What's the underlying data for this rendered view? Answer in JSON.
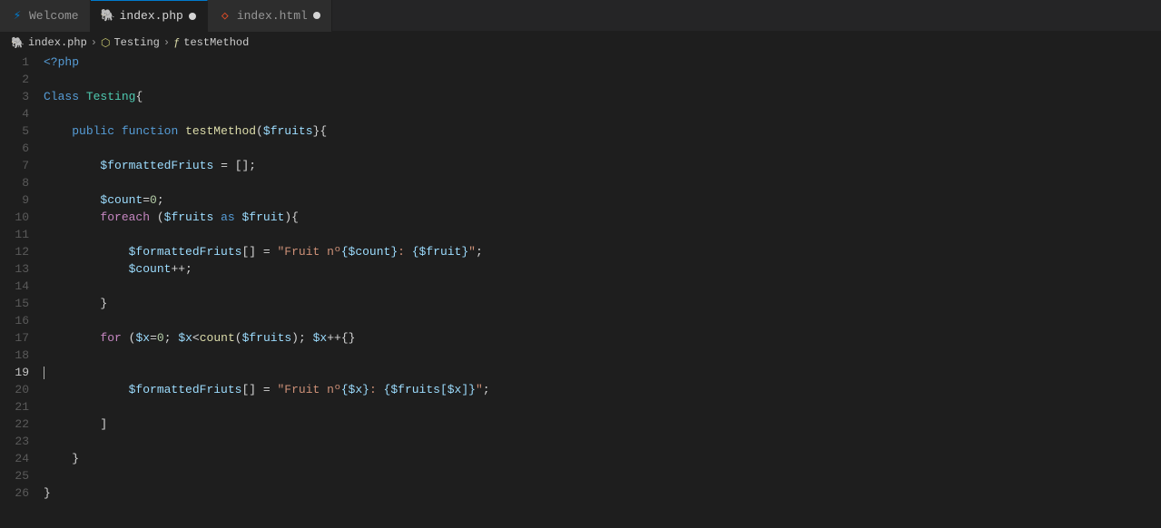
{
  "tabs": [
    {
      "id": "welcome",
      "label": "Welcome",
      "icon": "vscode",
      "active": false,
      "modified": false
    },
    {
      "id": "index-php",
      "label": "index.php",
      "icon": "php",
      "active": true,
      "modified": true
    },
    {
      "id": "index-html",
      "label": "index.html",
      "icon": "html",
      "active": false,
      "modified": true
    }
  ],
  "breadcrumb": {
    "items": [
      {
        "label": "index.php",
        "icon": "php"
      },
      {
        "label": "Testing",
        "icon": "class"
      },
      {
        "label": "testMethod",
        "icon": "method"
      }
    ]
  },
  "lines": [
    {
      "num": 1,
      "tokens": [
        {
          "t": "tag",
          "v": "<?php"
        }
      ]
    },
    {
      "num": 2,
      "tokens": []
    },
    {
      "num": 3,
      "tokens": [
        {
          "t": "kw",
          "v": "Class"
        },
        {
          "t": "plain",
          "v": " "
        },
        {
          "t": "cls",
          "v": "Testing"
        },
        {
          "t": "punct",
          "v": "{"
        }
      ]
    },
    {
      "num": 4,
      "tokens": []
    },
    {
      "num": 5,
      "tokens": [
        {
          "t": "plain",
          "v": "    "
        },
        {
          "t": "kw",
          "v": "public"
        },
        {
          "t": "plain",
          "v": " "
        },
        {
          "t": "kw",
          "v": "function"
        },
        {
          "t": "plain",
          "v": " "
        },
        {
          "t": "fn",
          "v": "testMethod"
        },
        {
          "t": "punct",
          "v": "("
        },
        {
          "t": "var",
          "v": "$fruits"
        },
        {
          "t": "punct",
          "v": "}{"
        }
      ]
    },
    {
      "num": 6,
      "tokens": []
    },
    {
      "num": 7,
      "tokens": [
        {
          "t": "plain",
          "v": "        "
        },
        {
          "t": "var",
          "v": "$formattedFriuts"
        },
        {
          "t": "plain",
          "v": " "
        },
        {
          "t": "op",
          "v": "="
        },
        {
          "t": "plain",
          "v": " "
        },
        {
          "t": "punct",
          "v": "[]"
        },
        {
          "t": "punct",
          "v": ";"
        }
      ]
    },
    {
      "num": 8,
      "tokens": []
    },
    {
      "num": 9,
      "tokens": [
        {
          "t": "plain",
          "v": "        "
        },
        {
          "t": "var",
          "v": "$count"
        },
        {
          "t": "op",
          "v": "="
        },
        {
          "t": "num",
          "v": "0"
        },
        {
          "t": "punct",
          "v": ";"
        }
      ]
    },
    {
      "num": 10,
      "tokens": [
        {
          "t": "plain",
          "v": "        "
        },
        {
          "t": "kw2",
          "v": "foreach"
        },
        {
          "t": "plain",
          "v": " "
        },
        {
          "t": "punct",
          "v": "("
        },
        {
          "t": "var",
          "v": "$fruits"
        },
        {
          "t": "plain",
          "v": " "
        },
        {
          "t": "kw",
          "v": "as"
        },
        {
          "t": "plain",
          "v": " "
        },
        {
          "t": "var",
          "v": "$fruit"
        },
        {
          "t": "punct",
          "v": "){"
        }
      ]
    },
    {
      "num": 11,
      "tokens": []
    },
    {
      "num": 12,
      "tokens": [
        {
          "t": "plain",
          "v": "            "
        },
        {
          "t": "var",
          "v": "$formattedFriuts"
        },
        {
          "t": "punct",
          "v": "[]"
        },
        {
          "t": "plain",
          "v": " "
        },
        {
          "t": "op",
          "v": "="
        },
        {
          "t": "plain",
          "v": " "
        },
        {
          "t": "str",
          "v": "\"Fruit nº"
        },
        {
          "t": "interp",
          "v": "{$count}"
        },
        {
          "t": "str",
          "v": ": "
        },
        {
          "t": "interp",
          "v": "{$fruit}"
        },
        {
          "t": "str",
          "v": "\""
        },
        {
          "t": "punct",
          "v": ";"
        }
      ]
    },
    {
      "num": 13,
      "tokens": [
        {
          "t": "plain",
          "v": "            "
        },
        {
          "t": "var",
          "v": "$count"
        },
        {
          "t": "op",
          "v": "++"
        },
        {
          "t": "punct",
          "v": ";"
        }
      ]
    },
    {
      "num": 14,
      "tokens": []
    },
    {
      "num": 15,
      "tokens": [
        {
          "t": "plain",
          "v": "        "
        },
        {
          "t": "punct",
          "v": "}"
        }
      ]
    },
    {
      "num": 16,
      "tokens": []
    },
    {
      "num": 17,
      "tokens": [
        {
          "t": "plain",
          "v": "        "
        },
        {
          "t": "kw2",
          "v": "for"
        },
        {
          "t": "plain",
          "v": " "
        },
        {
          "t": "punct",
          "v": "("
        },
        {
          "t": "var",
          "v": "$x"
        },
        {
          "t": "op",
          "v": "="
        },
        {
          "t": "num",
          "v": "0"
        },
        {
          "t": "punct",
          "v": ";"
        },
        {
          "t": "plain",
          "v": " "
        },
        {
          "t": "var",
          "v": "$x"
        },
        {
          "t": "op",
          "v": "<"
        },
        {
          "t": "fn",
          "v": "count"
        },
        {
          "t": "punct",
          "v": "("
        },
        {
          "t": "var",
          "v": "$fruits"
        },
        {
          "t": "punct",
          "v": ")"
        },
        {
          "t": "punct",
          "v": ";"
        },
        {
          "t": "plain",
          "v": " "
        },
        {
          "t": "var",
          "v": "$x"
        },
        {
          "t": "op",
          "v": "++"
        },
        {
          "t": "punct",
          "v": "{}"
        }
      ]
    },
    {
      "num": 18,
      "tokens": []
    },
    {
      "num": 19,
      "tokens": [],
      "active": true
    },
    {
      "num": 20,
      "tokens": [
        {
          "t": "plain",
          "v": "            "
        },
        {
          "t": "var",
          "v": "$formattedFriuts"
        },
        {
          "t": "punct",
          "v": "[]"
        },
        {
          "t": "plain",
          "v": " "
        },
        {
          "t": "op",
          "v": "="
        },
        {
          "t": "plain",
          "v": " "
        },
        {
          "t": "str",
          "v": "\"Fruit nº"
        },
        {
          "t": "interp",
          "v": "{$x}"
        },
        {
          "t": "str",
          "v": ": "
        },
        {
          "t": "interp",
          "v": "{$fruits[$x]}"
        },
        {
          "t": "str",
          "v": "\""
        },
        {
          "t": "punct",
          "v": ";"
        }
      ]
    },
    {
      "num": 21,
      "tokens": []
    },
    {
      "num": 22,
      "tokens": [
        {
          "t": "plain",
          "v": "        "
        },
        {
          "t": "punct",
          "v": "]"
        }
      ]
    },
    {
      "num": 23,
      "tokens": []
    },
    {
      "num": 24,
      "tokens": [
        {
          "t": "plain",
          "v": "    "
        },
        {
          "t": "punct",
          "v": "}"
        }
      ]
    },
    {
      "num": 25,
      "tokens": []
    },
    {
      "num": 26,
      "tokens": [
        {
          "t": "punct",
          "v": "}"
        }
      ]
    }
  ]
}
